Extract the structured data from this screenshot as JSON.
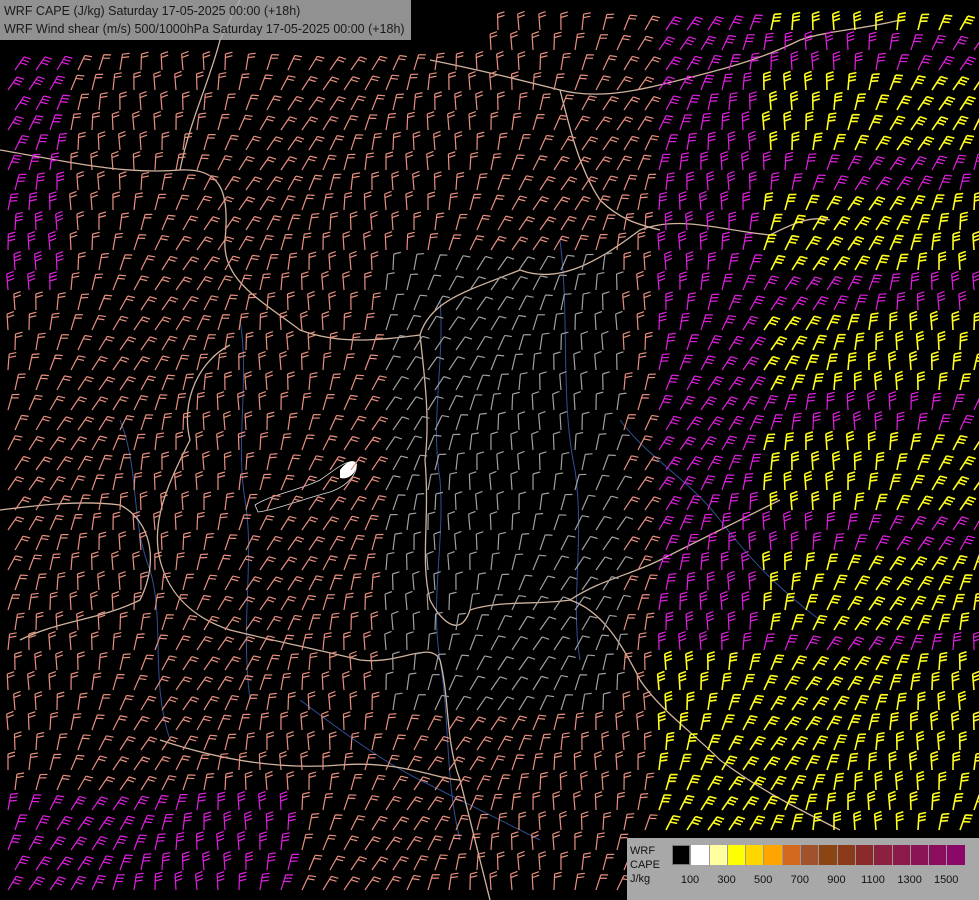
{
  "title": {
    "line1": "WRF CAPE (J/kg) Saturday 17-05-2025 00:00 (+18h)",
    "line2": "WRF Wind shear (m/s) 500/1000hPa Saturday 17-05-2025 00:00 (+18h)"
  },
  "legend": {
    "label1": "WRF",
    "label2": "CAPE",
    "label3": "J/kg",
    "ticks": [
      "100",
      "300",
      "500",
      "700",
      "900",
      "1100",
      "1300",
      "1500"
    ],
    "colors": [
      "#000000",
      "#ffffff",
      "#ffffa0",
      "#ffff00",
      "#ffd700",
      "#ffa500",
      "#d2691e",
      "#a0522d",
      "#8b4513",
      "#8b3a1a",
      "#8b2a2a",
      "#8b2040",
      "#8b1a4a",
      "#8b1454",
      "#8b0e5e",
      "#8b0868"
    ]
  },
  "map_colors": {
    "border": "#e8c8b0",
    "river": "#3a5fb0",
    "barb_weak": "#a0a0a0",
    "barb_mid": "#e89080",
    "barb_strong": "#e020e0",
    "barb_very_strong": "#ffff20"
  }
}
